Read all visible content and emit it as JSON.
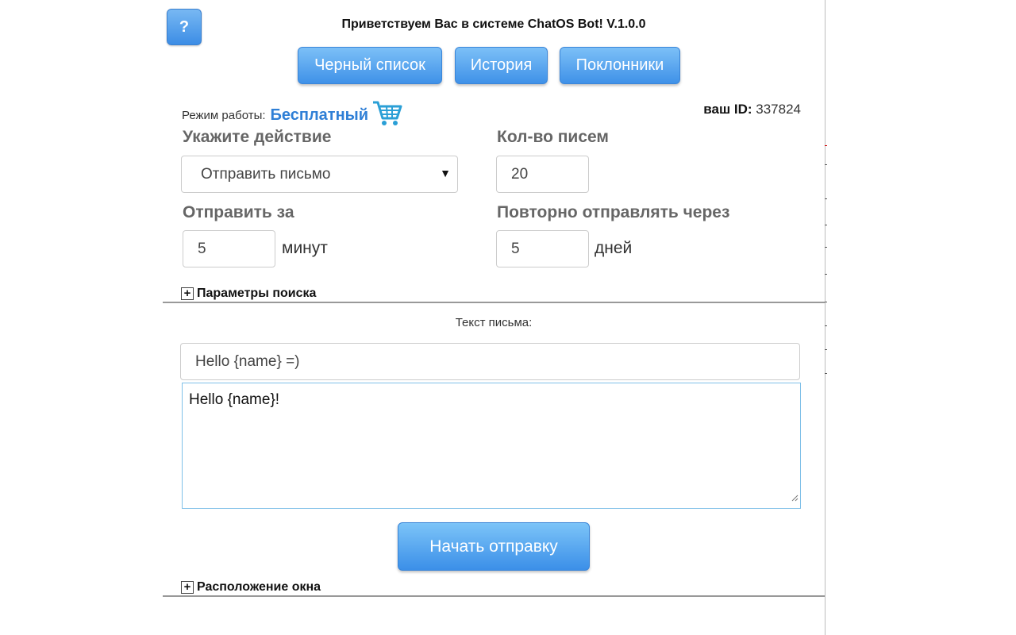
{
  "header": {
    "help_label": "?",
    "title": "Приветствуем Вас в системе ChatOS Bot! V.1.0.0"
  },
  "nav": {
    "blacklist": "Черный список",
    "history": "История",
    "fans": "Поклонники"
  },
  "status": {
    "mode_label": "Режим работы:",
    "mode_value": "Бесплатный",
    "cart_icon": "shopping-cart-icon",
    "id_label": "ваш ID:",
    "id_value": "337824"
  },
  "form": {
    "action_label": "Укажите действие",
    "action_value": "Отправить письмо",
    "count_label": "Кол-во писем",
    "count_value": "20",
    "send_within_label": "Отправить за",
    "send_within_value": "5",
    "send_within_unit": "минут",
    "resend_label": "Повторно отправлять через",
    "resend_value": "5",
    "resend_unit": "дней"
  },
  "search_params": {
    "icon": "plus-icon",
    "label": "Параметры поиска"
  },
  "letter": {
    "label": "Текст письма:",
    "subject": "Hello {name} =)",
    "body": "Hello {name}!"
  },
  "actions": {
    "start_label": "Начать отправку"
  },
  "window_position": {
    "icon": "plus-icon",
    "label": "Расположение окна"
  },
  "colors": {
    "accent": "#3f91e8",
    "mode_value": "#2f7fd6",
    "label_gray": "#666666"
  }
}
